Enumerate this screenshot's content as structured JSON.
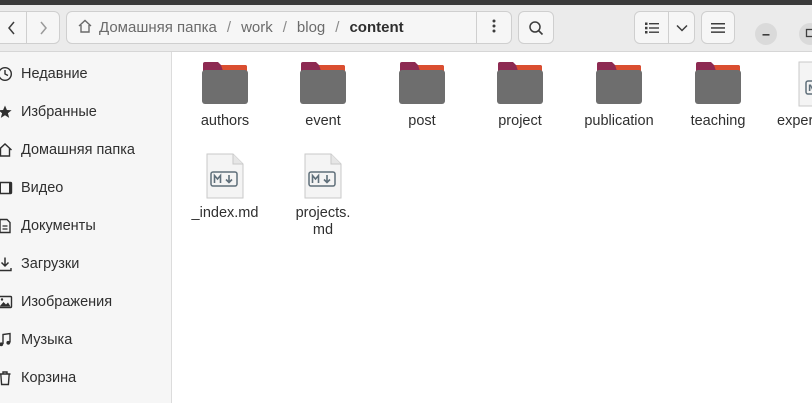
{
  "header": {
    "path": {
      "home_label": "Домашняя папка",
      "crumbs": [
        "work",
        "blog"
      ],
      "current": "content",
      "separator": "/"
    }
  },
  "sidebar": {
    "items": [
      {
        "label": "Недавние",
        "icon": "clock-icon"
      },
      {
        "label": "Избранные",
        "icon": "star-icon"
      },
      {
        "label": "Домашняя папка",
        "icon": "home-icon"
      },
      {
        "label": "Видео",
        "icon": "video-icon"
      },
      {
        "label": "Документы",
        "icon": "document-icon"
      },
      {
        "label": "Загрузки",
        "icon": "download-icon"
      },
      {
        "label": "Изображения",
        "icon": "image-icon"
      },
      {
        "label": "Музыка",
        "icon": "music-icon"
      },
      {
        "label": "Корзина",
        "icon": "trash-icon"
      }
    ]
  },
  "files": [
    {
      "name": "authors",
      "type": "folder"
    },
    {
      "name": "event",
      "type": "folder"
    },
    {
      "name": "post",
      "type": "folder"
    },
    {
      "name": "project",
      "type": "folder"
    },
    {
      "name": "publication",
      "type": "folder"
    },
    {
      "name": "teaching",
      "type": "folder"
    },
    {
      "name": "experi… m",
      "type": "markdown"
    },
    {
      "name": "_index.md",
      "type": "markdown"
    },
    {
      "name": "projects.\nmd",
      "type": "markdown"
    }
  ],
  "colors": {
    "folder_body": "#6e6e6e",
    "folder_tab": "#8d2a52",
    "folder_accent": "#e8552a",
    "header_bg": "#ebebeb",
    "sidebar_bg": "#f6f6f6"
  }
}
